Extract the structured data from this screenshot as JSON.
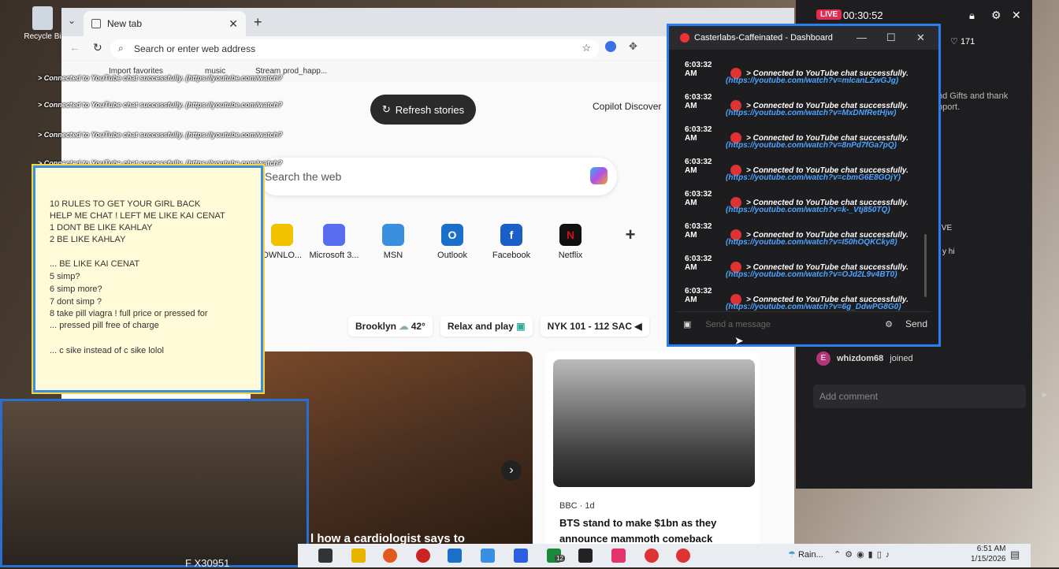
{
  "desktop": {
    "recycle_bin": "Recycle Bi"
  },
  "browser": {
    "tab_title": "New tab",
    "address_placeholder": "Search or enter web address",
    "favorites": [
      "Import favorites",
      "music",
      "Stream prod_happ..."
    ],
    "refresh_label": "Refresh stories",
    "copilot_label": "Copilot Discover",
    "search_placeholder": "Search the web",
    "tiles": [
      {
        "label": "DWNLO...",
        "color": "#f2c200"
      },
      {
        "label": "Microsoft 3...",
        "color": "#5a6cf0"
      },
      {
        "label": "MSN",
        "color": "#3a8fe0"
      },
      {
        "label": "Outlook",
        "color": "#1a6fc8"
      },
      {
        "label": "Facebook",
        "color": "#1a5fc8"
      },
      {
        "label": "Netflix",
        "color": "#d40f1a"
      }
    ],
    "weather_city": "Brooklyn",
    "weather_temp": "42°",
    "relax": "Relax and play",
    "score": "NYK  101 - 112  SAC",
    "card1_text": "l how a cardiologist says to",
    "card2_source": "BBC · 1d",
    "card2_headline": "BTS stand to make $1bn as they announce mammoth comeback"
  },
  "overlay": {
    "overlay_text": [
      "10 RULES TO GET YOUR GIRL BACK",
      "HELP ME CHAT ! LEFT ME LIKE KAI CENAT",
      "1 DONT BE LIKE KAHLAY",
      "2 BE LIKE KAHLAY",
      "... BE LIKE KAI CENAT",
      "5 simp?",
      "6 simp more?",
      "7 dont simp ?",
      "8 take pill viagra ! full price or pressed for",
      "... pressed pill free of charge",
      "... c sike instead of c sike lolol"
    ],
    "connected_line": "> Connected to YouTube chat successfully. (https://youtube.com/watch?"
  },
  "cam": {
    "label": "F X30951"
  },
  "casterlabs": {
    "title": "Casterlabs-Caffeinated - Dashboard",
    "messages": [
      {
        "time": "6:03:32 AM",
        "text": "> Connected to YouTube chat successfully.",
        "link": "(https://youtube.com/watch?v=mIcanLZwGJg)"
      },
      {
        "time": "6:03:32 AM",
        "text": "> Connected to YouTube chat successfully.",
        "link": "(https://youtube.com/watch?v=MxDNfRetHjw)"
      },
      {
        "time": "6:03:32 AM",
        "text": "> Connected to YouTube chat successfully.",
        "link": "(https://youtube.com/watch?v=8nPd7fGa7pQ)"
      },
      {
        "time": "6:03:32 AM",
        "text": "> Connected to YouTube chat successfully.",
        "link": "(https://youtube.com/watch?v=cbmG6E8GOjY)"
      },
      {
        "time": "6:03:32 AM",
        "text": "> Connected to YouTube chat successfully.",
        "link": "(https://youtube.com/watch?v=k-_Vtj850TQ)"
      },
      {
        "time": "6:03:32 AM",
        "text": "> Connected to YouTube chat successfully.",
        "link": "(https://youtube.com/watch?v=I50hOQKCky8)"
      },
      {
        "time": "6:03:32 AM",
        "text": "> Connected to YouTube chat successfully.",
        "link": "(https://youtube.com/watch?v=OJd2L9v4BT0)"
      },
      {
        "time": "6:03:32 AM",
        "text": "> Connected to YouTube chat successfully.",
        "link": "(https://youtube.com/watch?v=6g_DdwPG8G0)"
      }
    ],
    "input_placeholder": "Send a message",
    "send_label": "Send"
  },
  "tiktok": {
    "live_badge": "LIVE",
    "timer": "00:30:52",
    "likes": "171",
    "snippet1": "nd Gifts and thank",
    "snippet2": "pport.",
    "snippet3": "IVE",
    "snippet4": "y hi",
    "joined_user": "whizdom68",
    "joined_text": "joined",
    "comment_placeholder": "Add comment"
  },
  "taskbar": {
    "weather": "Rain...",
    "time": "6:51 AM",
    "date": "1/15/2026",
    "badge": "12"
  }
}
